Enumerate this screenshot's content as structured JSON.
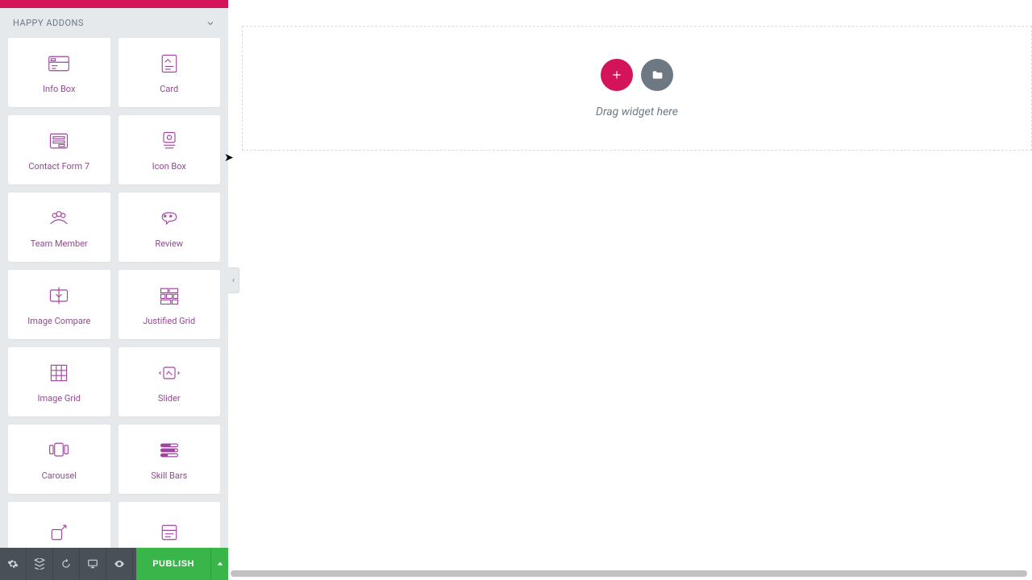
{
  "category": {
    "title": "HAPPY ADDONS"
  },
  "widgets": [
    {
      "label": "Info Box"
    },
    {
      "label": "Card"
    },
    {
      "label": "Contact Form 7"
    },
    {
      "label": "Icon Box"
    },
    {
      "label": "Team Member"
    },
    {
      "label": "Review"
    },
    {
      "label": "Image Compare"
    },
    {
      "label": "Justified Grid"
    },
    {
      "label": "Image Grid"
    },
    {
      "label": "Slider"
    },
    {
      "label": "Carousel"
    },
    {
      "label": "Skill Bars"
    },
    {
      "label": ""
    },
    {
      "label": ""
    }
  ],
  "footer": {
    "publish_label": "PUBLISH"
  },
  "canvas": {
    "hint": "Drag widget here"
  }
}
